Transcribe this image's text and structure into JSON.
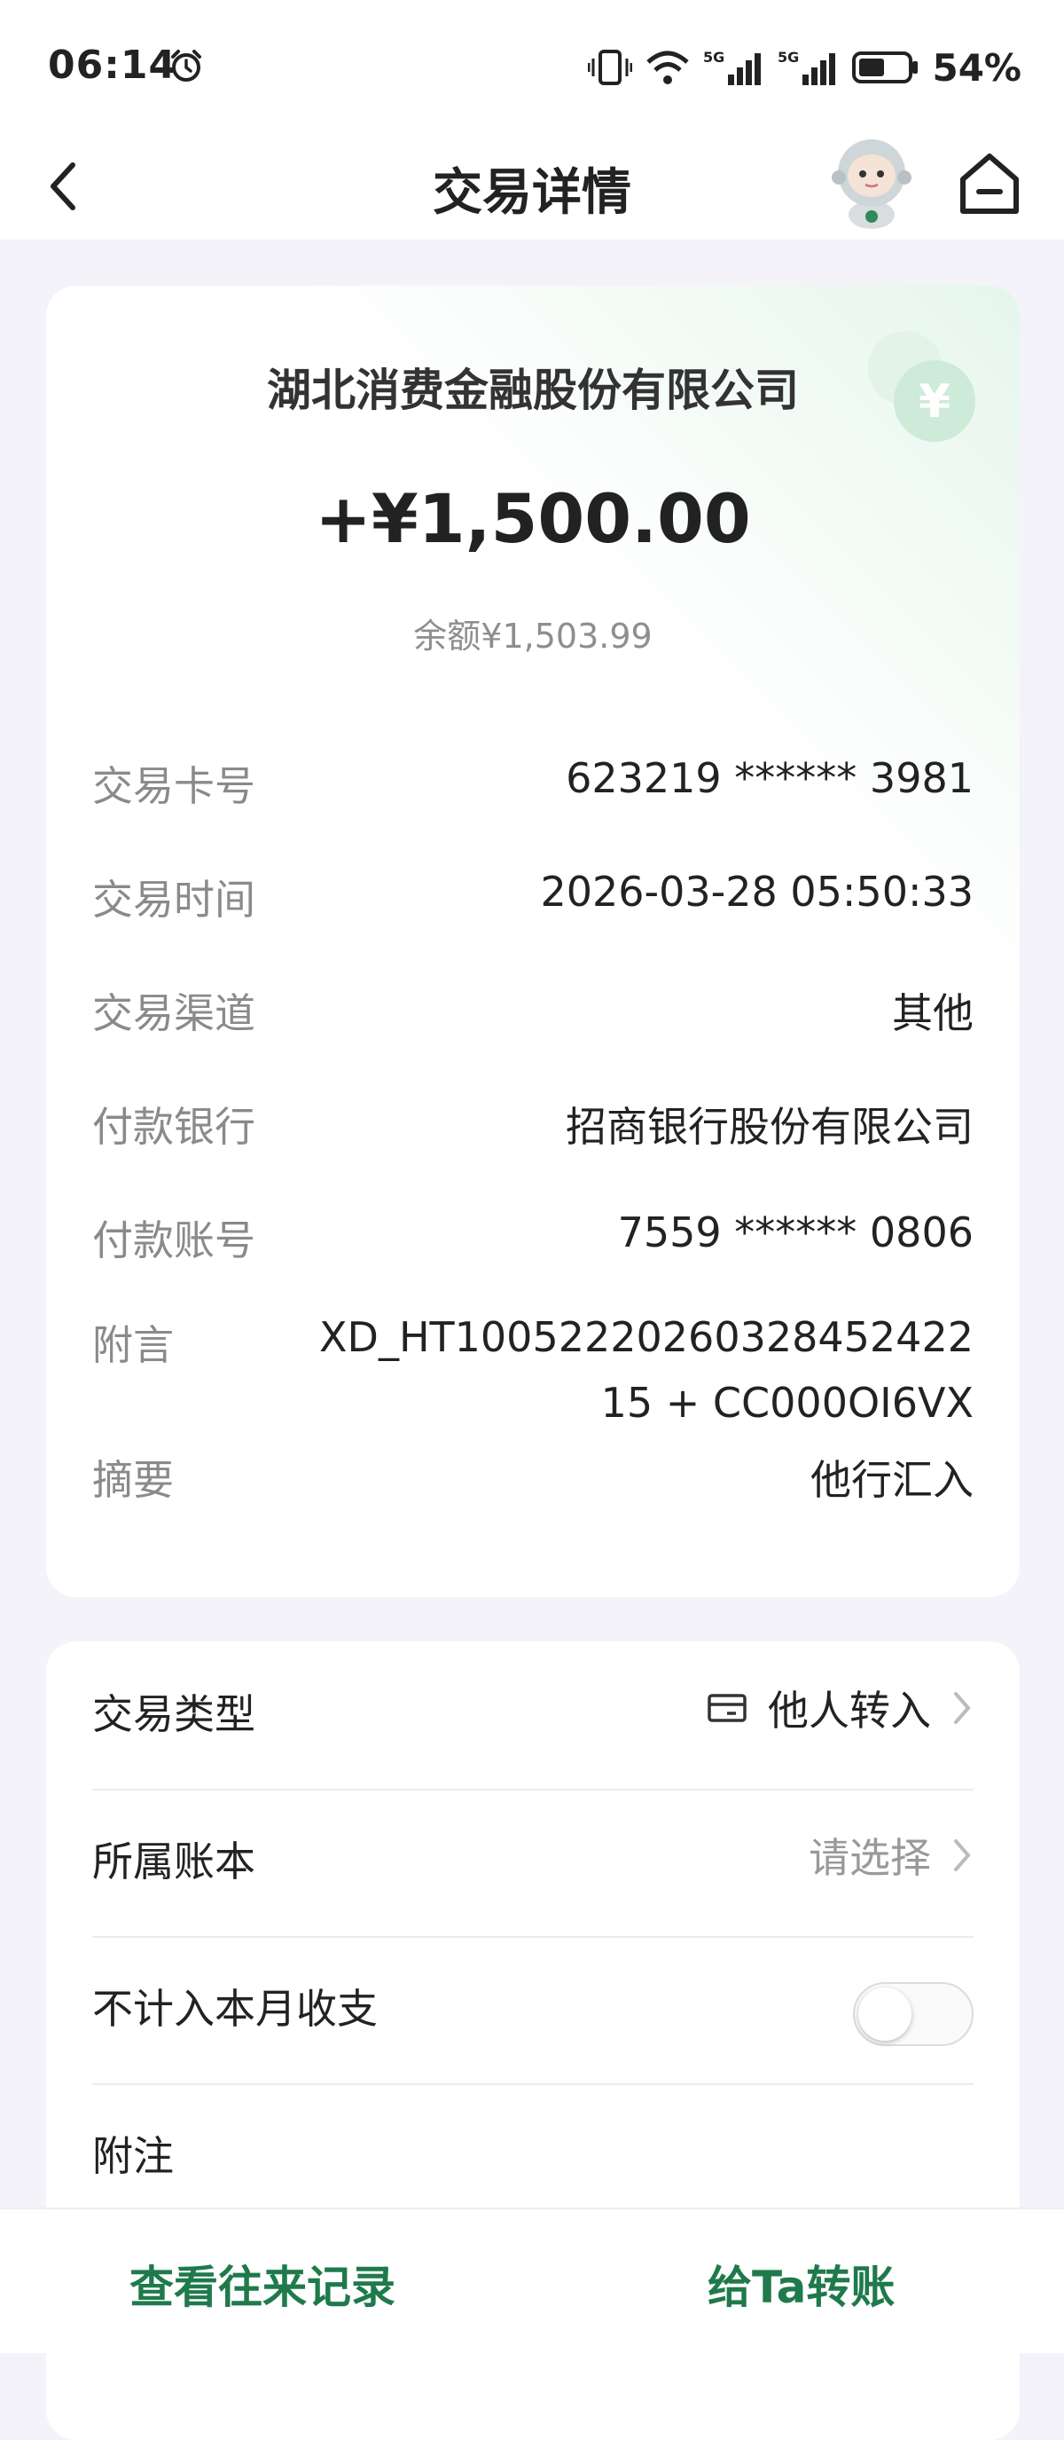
{
  "status_bar": {
    "time": "06:14",
    "battery_percent": "54%",
    "icons": [
      "alarm-icon",
      "vibrate-icon",
      "wifi-icon",
      "5g-signal-icon",
      "5g-signal-icon",
      "battery-icon"
    ]
  },
  "header": {
    "title": "交易详情",
    "icons": [
      "back-icon",
      "mascot-avatar",
      "home-icon"
    ]
  },
  "summary": {
    "company": "湖北消费金融股份有限公司",
    "amount": "+¥1,500.00",
    "balance": "余额¥1,503.99"
  },
  "details": [
    {
      "label": "交易卡号",
      "value": "623219 ****** 3981"
    },
    {
      "label": "交易时间",
      "value": "2026-03-28 05:50:33"
    },
    {
      "label": "交易渠道",
      "value": "其他"
    },
    {
      "label": "付款银行",
      "value": "招商银行股份有限公司"
    },
    {
      "label": "付款账号",
      "value": "7559 ****** 0806"
    },
    {
      "label": "附言",
      "value": "XD_HT1005222026032845242215 + CC000OI6VX"
    },
    {
      "label": "摘要",
      "value": "他行汇入"
    }
  ],
  "settings": {
    "transaction_type": {
      "label": "交易类型",
      "value": "他人转入"
    },
    "ledger": {
      "label": "所属账本",
      "placeholder": "请选择"
    },
    "exclude_monthly": {
      "label": "不计入本月收支",
      "enabled": false
    },
    "note": {
      "label": "附注"
    }
  },
  "bottom_bar": {
    "history_button": "查看往来记录",
    "transfer_button": "给Ta转账"
  },
  "colors": {
    "accent_green": "#1f7a4b",
    "page_bg": "#f4f3f9"
  }
}
